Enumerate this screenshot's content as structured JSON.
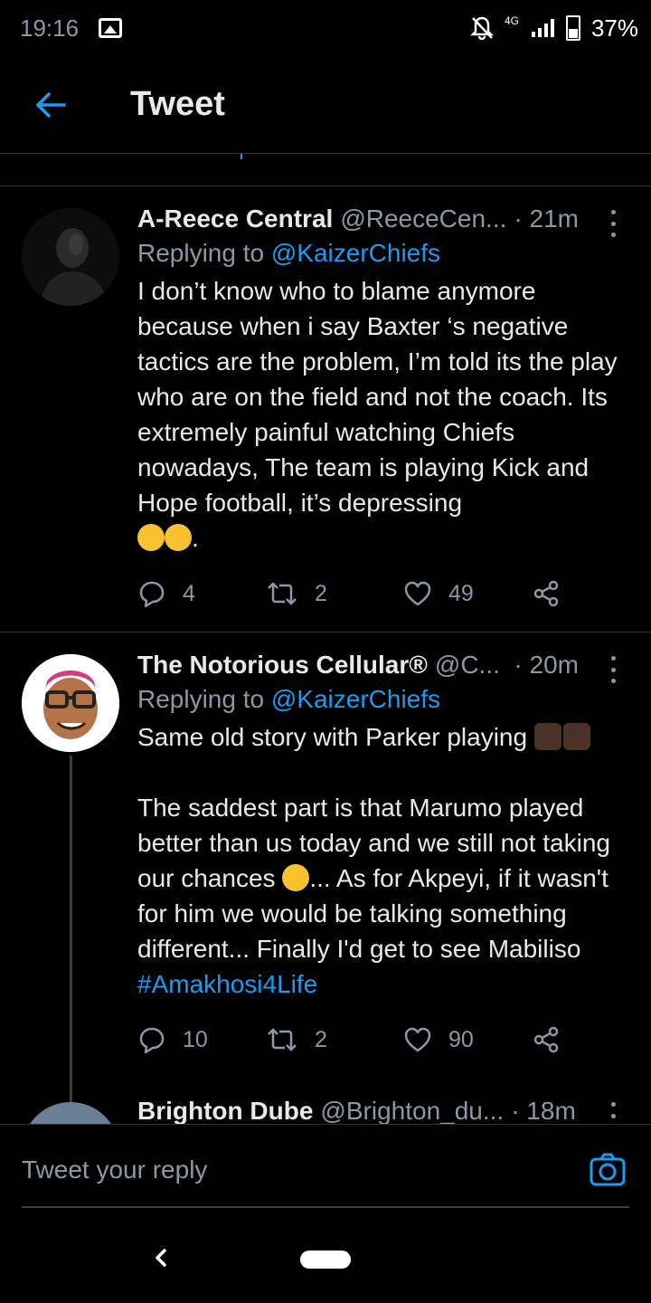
{
  "status_bar": {
    "time": "19:16",
    "network": "4G",
    "battery": "37%"
  },
  "header": {
    "title": "Tweet"
  },
  "tweets": [
    {
      "name": "A-Reece Central",
      "handle": "@ReeceCen...",
      "time": "· 21m",
      "reply_prefix": "Replying to",
      "reply_to": "@KaizerChiefs",
      "text": "I don’t know who to blame anymore because when i say Baxter ‘s negative tactics are the problem, I’m told its the play who are on the field and not the coach. Its extremely painful watching Chiefs nowadays, The team is playing Kick and Hope football, it’s depressing",
      "text_end": ".",
      "replies": "4",
      "retweets": "2",
      "likes": "49"
    },
    {
      "name": "The Notorious Cellular®",
      "handle": "@C...",
      "time": "· 20m",
      "reply_prefix": "Replying to",
      "reply_to": "@KaizerChiefs",
      "text_line1": "Same old story with Parker playing",
      "text_part2": "The saddest part is that Marumo played better than us today and we still not taking our chances",
      "text_part3": "... As for Akpeyi, if it wasn't for him we would be talking something different... Finally I'd get to see Mabiliso",
      "hashtag": "#Amakhosi4Life",
      "replies": "10",
      "retweets": "2",
      "likes": "90"
    },
    {
      "name": "Brighton Dube",
      "handle": "@Brighton_du...",
      "time": "· 18m"
    }
  ],
  "reply_bar": {
    "placeholder": "Tweet your reply"
  },
  "colors": {
    "accent": "#1d9bf0",
    "background": "#000000",
    "muted": "#8b98a5"
  }
}
